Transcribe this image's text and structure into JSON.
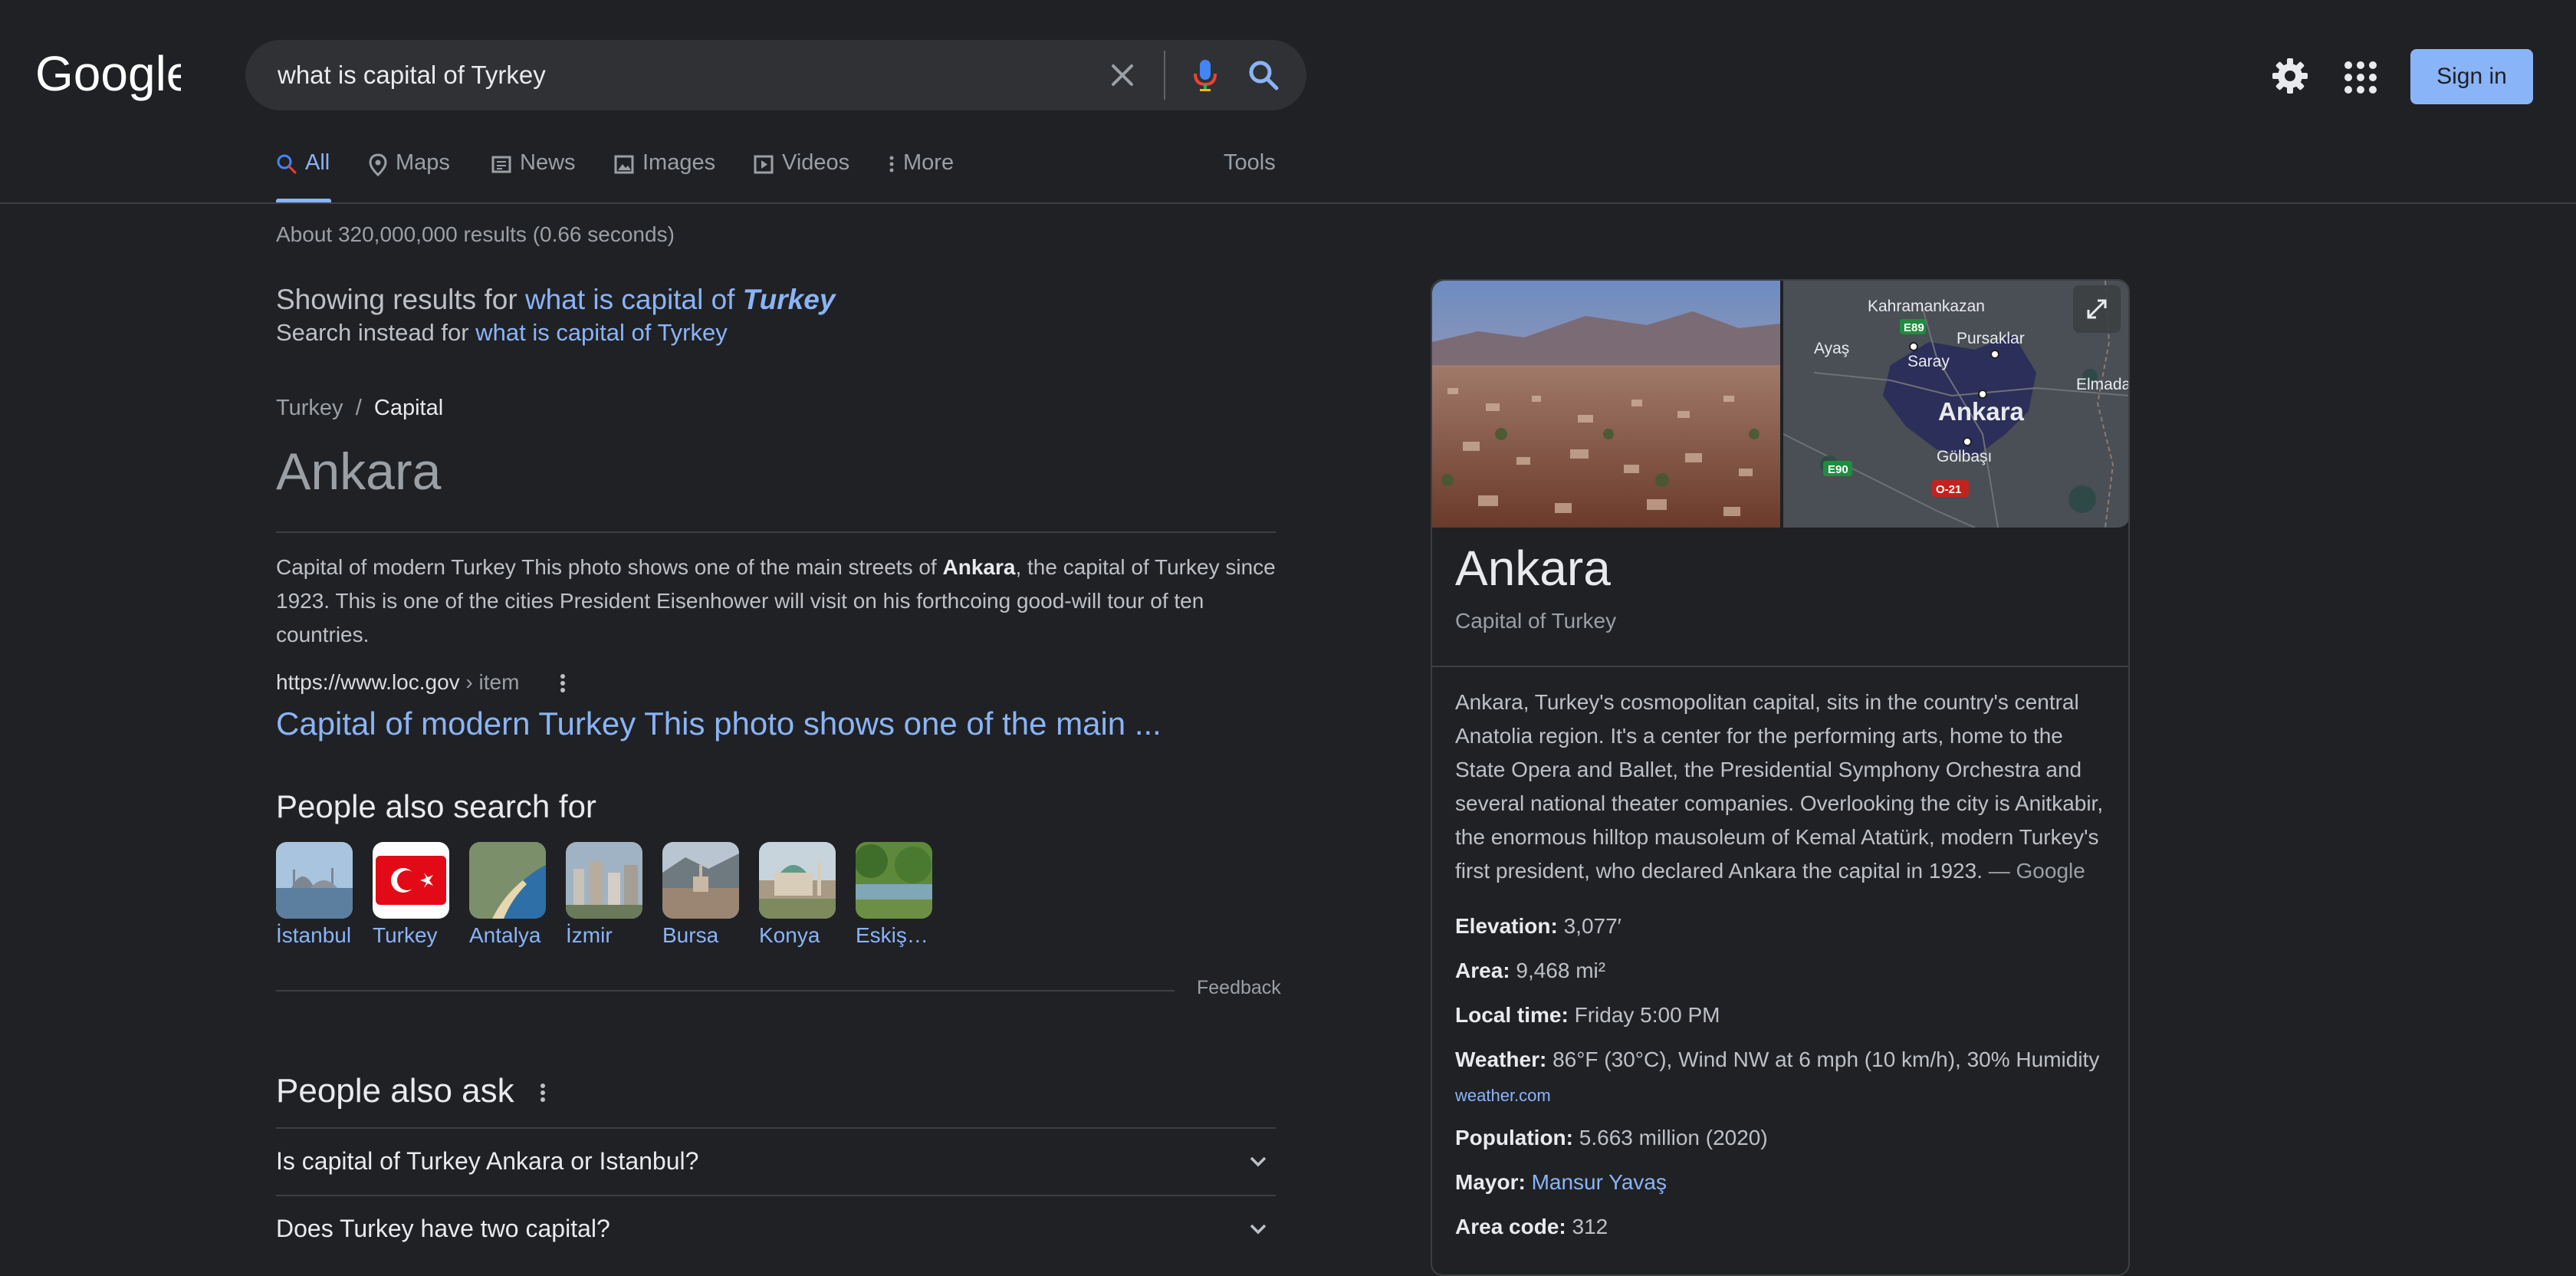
{
  "search": {
    "query": "what is capital of Tyrkey"
  },
  "header": {
    "sign_in": "Sign in"
  },
  "tabs": [
    {
      "label": "All"
    },
    {
      "label": "Maps"
    },
    {
      "label": "News"
    },
    {
      "label": "Images"
    },
    {
      "label": "Videos"
    },
    {
      "label": "More"
    },
    {
      "label": "Tools"
    }
  ],
  "results": {
    "stats": "About 320,000,000 results (0.66 seconds)",
    "showing_prefix": "Showing results for",
    "showing_link": "what is capital of",
    "showing_corrected": "Turkey",
    "instead_prefix": "Search instead for",
    "instead_link": "what is capital of Tyrkey"
  },
  "featured": {
    "breadcrumb_parent": "Turkey",
    "breadcrumb_sep": "/",
    "breadcrumb_current": "Capital",
    "answer": "Ankara",
    "snippet_1": "Capital of modern Turkey This photo shows one of the main streets of",
    "snippet_bold": "Ankara",
    "snippet_2": ", the capital of Turkey since 1923. This is one of the cities President Eisenhower will visit on his forthcoing good-will tour of ten countries.",
    "source_domain": "https://www.loc.gov",
    "source_path": " › item",
    "source_title": "Capital of modern Turkey This photo shows one of the main ..."
  },
  "people_also_search": {
    "heading": "People also search for",
    "items": [
      {
        "label": "İstanbul"
      },
      {
        "label": "Turkey"
      },
      {
        "label": "Antalya"
      },
      {
        "label": "İzmir"
      },
      {
        "label": "Bursa"
      },
      {
        "label": "Konya"
      },
      {
        "label": "Eskişe…"
      }
    ],
    "feedback": "Feedback"
  },
  "people_also_ask": {
    "heading": "People also ask",
    "questions": [
      {
        "q": "Is capital of Turkey Ankara or Istanbul?"
      },
      {
        "q": "Does Turkey have two capital?"
      }
    ]
  },
  "knowledge_panel": {
    "title": "Ankara",
    "subtitle": "Capital of Turkey",
    "map_labels": {
      "kahramankazan": "Kahramankazan",
      "e89": "E89",
      "ayas": "Ayaş",
      "pursaklar": "Pursaklar",
      "saray": "Saray",
      "elmadag": "Elmadağ",
      "ankara": "Ankara",
      "golbasi": "Gölbaşı",
      "e90": "E90",
      "o21": "O-21"
    },
    "description": "Ankara, Turkey's cosmopolitan capital, sits in the country's central Anatolia region. It's a center for the performing arts, home to the State Opera and Ballet, the Presidential Symphony Orchestra and several national theater companies. Overlooking the city is Anitkabir, the enormous hilltop mausoleum of Kemal Atatürk, modern Turkey's first president, who declared Ankara the capital in 1923.",
    "description_source": "— Google",
    "facts": {
      "elevation_label": "Elevation:",
      "elevation": "3,077′",
      "area_label": "Area:",
      "area": "9,468 mi²",
      "localtime_label": "Local time:",
      "localtime": "Friday 5:00 PM",
      "weather_label": "Weather:",
      "weather": "86°F (30°C), Wind NW at 6 mph (10 km/h), 30% Humidity",
      "weather_source": "weather.com",
      "population_label": "Population:",
      "population": "5.663 million (2020)",
      "mayor_label": "Mayor:",
      "mayor": "Mansur Yavaş",
      "areacode_label": "Area code:",
      "areacode": "312"
    }
  }
}
